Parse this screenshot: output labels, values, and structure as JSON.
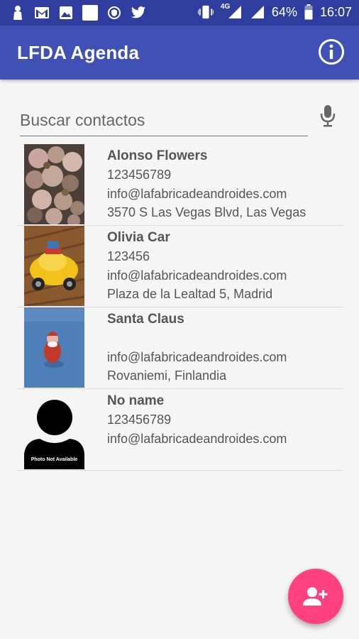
{
  "statusbar": {
    "battery": "64%",
    "time": "16:07",
    "network": "4G",
    "left_icons": [
      "person-icon",
      "gmail-icon",
      "image-icon",
      "square-icon",
      "shield-icon",
      "twitter-icon"
    ],
    "right_icons": [
      "vibrate-icon",
      "signal-icon",
      "signal-icon",
      "battery-icon"
    ]
  },
  "appbar": {
    "title": "LFDA Agenda",
    "info_icon": "info-icon"
  },
  "search": {
    "placeholder": "Buscar contactos",
    "value": "",
    "mic_icon": "mic-icon"
  },
  "contacts": [
    {
      "name": "Alonso Flowers",
      "phone": "123456789",
      "email": "info@lafabricadeandroides.com",
      "address": "3570 S Las Vegas Blvd, Las Vegas"
    },
    {
      "name": "Olivia Car",
      "phone": "123456",
      "email": "info@lafabricadeandroides.com",
      "address": "Plaza de la Lealtad 5, Madrid"
    },
    {
      "name": "Santa Claus",
      "phone": "",
      "email": "info@lafabricadeandroides.com",
      "address": "Rovaniemi, Finlandia"
    },
    {
      "name": "No name",
      "phone": "123456789",
      "email": "info@lafabricadeandroides.com",
      "address": "",
      "photo_label": "Photo Not Available"
    }
  ],
  "fab": {
    "icon": "add-contact-icon"
  },
  "colors": {
    "primary": "#3f51b5",
    "primary_dark": "#2f3e9e",
    "accent": "#ff4081",
    "background": "#f5f5f5",
    "text": "#555555"
  }
}
